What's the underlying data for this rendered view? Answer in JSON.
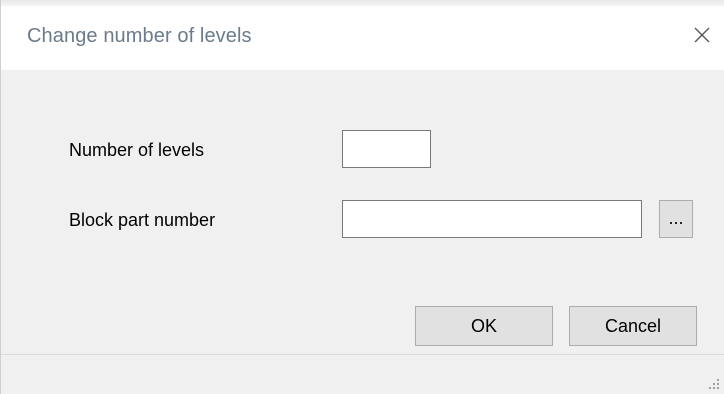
{
  "window": {
    "title": "Change number of levels",
    "close_icon": "close-icon"
  },
  "form": {
    "levels_label": "Number of levels",
    "levels_value": "",
    "block_label": "Block part number",
    "block_value": "",
    "browse_label": "..."
  },
  "buttons": {
    "ok_label": "OK",
    "cancel_label": "Cancel"
  },
  "colors": {
    "title_text": "#6b7b8c",
    "dialog_bg": "#f0f0f0",
    "button_bg": "#e1e1e1",
    "button_border": "#adadad"
  },
  "status": {
    "grip_icon": "resize-grip-icon"
  }
}
